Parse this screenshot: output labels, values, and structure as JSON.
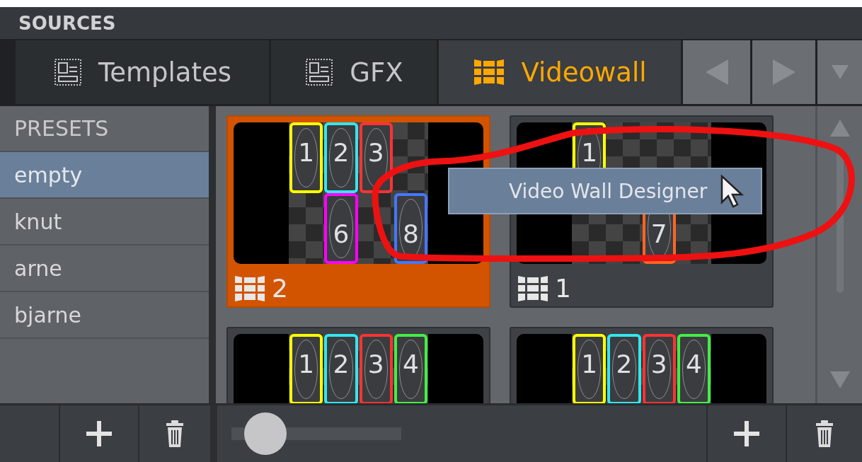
{
  "panel": {
    "title": "SOURCES"
  },
  "tabs": [
    {
      "label": "Templates",
      "kind": "template",
      "selected": false
    },
    {
      "label": "GFX",
      "kind": "template",
      "selected": false
    },
    {
      "label": "Videowall",
      "kind": "wall",
      "selected": true
    }
  ],
  "presets": {
    "title": "PRESETS",
    "items": [
      {
        "label": "empty",
        "selected": true
      },
      {
        "label": "knut",
        "selected": false
      },
      {
        "label": "arne",
        "selected": false
      },
      {
        "label": "bjarne",
        "selected": false
      }
    ]
  },
  "walls": [
    {
      "selected": true,
      "count": "2",
      "slots": [
        {
          "kind": "output",
          "label": "1",
          "color": "#ffff00"
        },
        {
          "kind": "output",
          "label": "2",
          "color": "#33e6f0"
        },
        {
          "kind": "output",
          "label": "3",
          "color": "#ff3333"
        },
        {
          "kind": "empty"
        },
        {
          "kind": "empty"
        },
        {
          "kind": "output",
          "label": "6",
          "color": "#ff00ff"
        },
        {
          "kind": "empty"
        },
        {
          "kind": "output",
          "label": "8",
          "color": "#4477ff"
        }
      ]
    },
    {
      "selected": false,
      "count": "1",
      "slots": [
        {
          "kind": "output",
          "label": "1",
          "color": "#ffff00"
        },
        {
          "kind": "empty"
        },
        {
          "kind": "empty"
        },
        {
          "kind": "empty"
        },
        {
          "kind": "empty"
        },
        {
          "kind": "empty"
        },
        {
          "kind": "output",
          "label": "7",
          "color": "#ff6622"
        },
        {
          "kind": "empty"
        }
      ]
    },
    {
      "selected": false,
      "slots": [
        {
          "kind": "output",
          "label": "1",
          "color": "#ffff00"
        },
        {
          "kind": "output",
          "label": "2",
          "color": "#33e6f0"
        },
        {
          "kind": "output",
          "label": "3",
          "color": "#ff3333"
        },
        {
          "kind": "output",
          "label": "4",
          "color": "#44ee44"
        }
      ]
    },
    {
      "selected": false,
      "slots": [
        {
          "kind": "output",
          "label": "1",
          "color": "#ffff00"
        },
        {
          "kind": "output",
          "label": "2",
          "color": "#33e6f0"
        },
        {
          "kind": "output",
          "label": "3",
          "color": "#ff3333"
        },
        {
          "kind": "output",
          "label": "4",
          "color": "#44ee44"
        }
      ]
    }
  ],
  "zoom_slider": {
    "level": 0.1
  },
  "context_menu": {
    "items": [
      "Video Wall Designer"
    ]
  }
}
